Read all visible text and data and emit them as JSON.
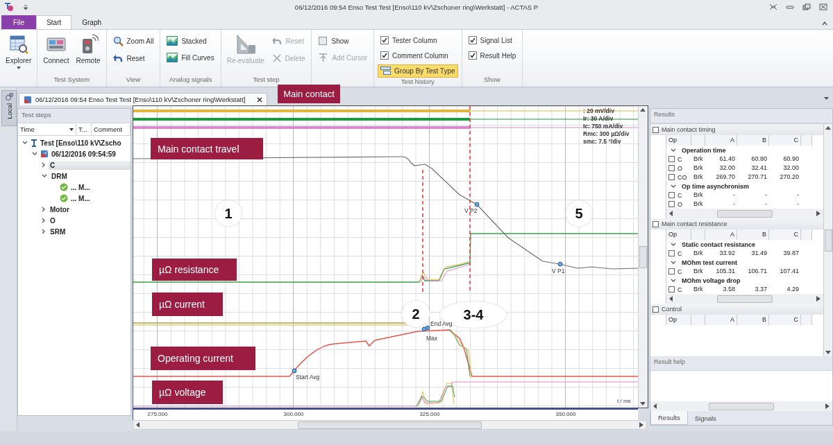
{
  "window": {
    "title": "06/12/2016 09:54 Enso Test Test [Enso\\110 kV\\Zschoner ring\\Werkstatt] - ACTAS P"
  },
  "ribbon_tabs": [
    {
      "label": "File",
      "kind": "file",
      "selected": false
    },
    {
      "label": "Start",
      "kind": "tab",
      "selected": true
    },
    {
      "label": "Graph",
      "kind": "tab",
      "selected": false
    }
  ],
  "ribbon_groups": [
    {
      "items": [
        {
          "kind": "large",
          "label": "Explorer",
          "disabled": false,
          "dropdown": true
        }
      ]
    },
    {
      "label": "Test System",
      "items": [
        {
          "kind": "large",
          "label": "Connect",
          "disabled": false
        },
        {
          "kind": "large",
          "label": "Remote",
          "disabled": false
        }
      ]
    },
    {
      "label": "View",
      "items": [
        {
          "kind": "small",
          "label": "Zoom All",
          "disabled": false
        },
        {
          "kind": "small",
          "label": "Reset",
          "disabled": false
        }
      ]
    },
    {
      "label": "Analog signals",
      "items": [
        {
          "kind": "small",
          "label": "Stacked",
          "disabled": false
        },
        {
          "kind": "small",
          "label": "Fill Curves",
          "disabled": false
        }
      ]
    },
    {
      "label": "Test step",
      "items": [
        {
          "kind": "large",
          "label": "Re-evaluate",
          "disabled": true
        },
        {
          "kind": "small",
          "label": "Reset",
          "disabled": true
        },
        {
          "kind": "small",
          "label": "Delete",
          "disabled": true
        }
      ]
    },
    {
      "items": [
        {
          "kind": "small",
          "label": "Show",
          "disabled": false
        },
        {
          "kind": "small",
          "label": "Add Cursor",
          "disabled": true
        }
      ]
    },
    {
      "label": "Test history",
      "items": [
        {
          "kind": "check",
          "label": "Tester Column",
          "checked": true
        },
        {
          "kind": "check",
          "label": "Comment Column",
          "checked": true
        },
        {
          "kind": "toggle",
          "label": "Group By Test Type",
          "selected": true
        }
      ]
    },
    {
      "label": "Show",
      "items": [
        {
          "kind": "check",
          "label": "Signal List",
          "checked": true
        },
        {
          "kind": "check",
          "label": "Result Help",
          "checked": true
        }
      ]
    }
  ],
  "side_tab": {
    "label": "Local"
  },
  "document_tab": {
    "label": "06/12/2016 09:54 Enso Test Test [Enso\\110 kV\\Zschoner ring\\Werkstatt]"
  },
  "banner": "Main contact",
  "test_steps": {
    "title": "Test steps",
    "columns": [
      "Time",
      "T...",
      "Comment"
    ],
    "tree": [
      {
        "label": "Test [Enso\\110 kV\\Zscho",
        "kind": "test",
        "expanded": true,
        "selected": false,
        "children": [
          {
            "label": "06/12/2016 09:54:59",
            "kind": "session",
            "expanded": true,
            "selected": false,
            "children": [
              {
                "label": "C",
                "expanded": false,
                "selected": true
              },
              {
                "label": "DRM",
                "expanded": true,
                "selected": false,
                "children": [
                  {
                    "label": "... M...",
                    "kind": "result",
                    "selected": false
                  },
                  {
                    "label": "... M...",
                    "kind": "result",
                    "selected": false
                  }
                ]
              },
              {
                "label": "Motor",
                "expanded": false,
                "selected": false
              },
              {
                "label": "O",
                "expanded": false,
                "selected": false
              },
              {
                "label": "SRM",
                "expanded": false,
                "selected": false
              }
            ]
          }
        ]
      }
    ]
  },
  "chart": {
    "annotations": [
      "Main contact travel",
      "µΩ resistance",
      "µΩ current",
      "Operating current",
      "µΩ voltage"
    ],
    "step_badges": [
      "1",
      "2",
      "3-4",
      "5"
    ],
    "scales": [
      ": 20 mV/div",
      "Ir: 30 A/div",
      "Ic: 750 mA/div",
      "Rmc: 300 µΩ/div",
      "smc: 7.5 °/div"
    ],
    "markers": [
      "V P2",
      "V P1",
      "Start Avg",
      "End Avg",
      "Max"
    ],
    "x_ticks": [
      "275.000",
      "300.000",
      "325.000",
      "350.000"
    ],
    "axis_unit": "t / ms"
  },
  "results": {
    "title": "Results",
    "sections": [
      {
        "title": "Main contact timing",
        "expanded": true,
        "columns": [
          "Op",
          "A",
          "B",
          "C"
        ],
        "groups": [
          {
            "title": "Operation time",
            "expanded": true,
            "rows": [
              {
                "op": "C",
                "type": "Brk",
                "values": [
                  "61.40",
                  "60.80",
                  "60.90"
                ]
              },
              {
                "op": "O",
                "type": "Brk",
                "values": [
                  "32.00",
                  "32.41",
                  "32.00"
                ]
              },
              {
                "op": "CO",
                "type": "Brk",
                "values": [
                  "269.70",
                  "270.71",
                  "270.20"
                ]
              }
            ]
          },
          {
            "title": "Op time asynchronism",
            "expanded": true,
            "rows": [
              {
                "op": "C",
                "type": "Brk",
                "values": [
                  "-",
                  "-",
                  "-"
                ]
              },
              {
                "op": "O",
                "type": "Brk",
                "values": [
                  "-",
                  "-",
                  "-"
                ]
              }
            ]
          }
        ]
      },
      {
        "title": "Main contact resistance",
        "expanded": true,
        "columns": [
          "Op",
          "A",
          "B",
          "C"
        ],
        "groups": [
          {
            "title": "Static contact resistance",
            "expanded": true,
            "rows": [
              {
                "op": "C",
                "type": "Brk",
                "values": [
                  "33.92",
                  "31.49",
                  "39.87"
                ]
              }
            ]
          },
          {
            "title": "MOhm test current",
            "expanded": true,
            "rows": [
              {
                "op": "C",
                "type": "Brk",
                "values": [
                  "105.31",
                  "106.71",
                  "107.41"
                ]
              }
            ]
          },
          {
            "title": "MOhm voltage drop",
            "expanded": true,
            "rows": [
              {
                "op": "C",
                "type": "Brk",
                "values": [
                  "3.58",
                  "3.37",
                  "4.29"
                ]
              }
            ]
          }
        ]
      },
      {
        "title": "Control",
        "expanded": true,
        "columns": [
          "Op",
          "A",
          "B",
          "C"
        ]
      }
    ]
  },
  "result_help": {
    "title": "Result help"
  },
  "panel_tabs": [
    {
      "label": "Results",
      "selected": true
    },
    {
      "label": "Signals",
      "selected": false
    }
  ]
}
